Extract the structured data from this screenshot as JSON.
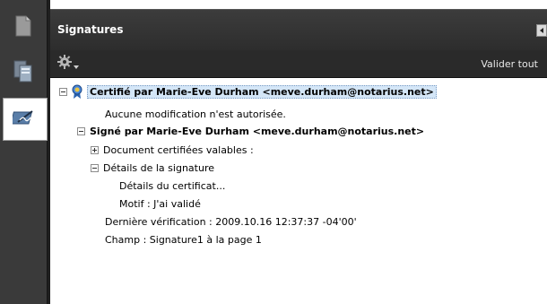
{
  "panel": {
    "title": "Signatures",
    "validate_all": "Valider tout"
  },
  "rail": {
    "items": [
      {
        "name": "pages-panel-icon"
      },
      {
        "name": "attachments-panel-icon"
      },
      {
        "name": "signatures-panel-icon",
        "active": true
      }
    ]
  },
  "tree": {
    "certified_label": "Certifié par Marie-Eve Durham <meve.durham@notarius.net>",
    "no_changes": "Aucune modification n'est autorisée.",
    "signed_label": "Signé par Marie-Eve Durham <meve.durham@notarius.net>",
    "certified_docs": "Document certifiées valables :",
    "sig_details": "Détails de la signature",
    "cert_details": "Détails du certificat...",
    "reason": "Motif : J'ai validé",
    "last_check": "Dernière vérification : 2009.10.16 12:37:37 -04'00'",
    "field": "Champ : Signature1 à la page 1"
  }
}
